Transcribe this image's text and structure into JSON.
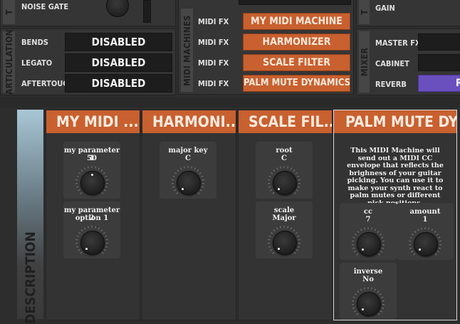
{
  "top_left": {
    "section_tab": "T",
    "noise_gate_label": "NOISE GATE"
  },
  "articulation": {
    "tab_label": "ARTICULATION",
    "rows": [
      {
        "label": "BENDS",
        "value": "DISABLED"
      },
      {
        "label": "LEGATO",
        "value": "DISABLED"
      },
      {
        "label": "AFTERTOUCH",
        "value": "DISABLED"
      }
    ]
  },
  "midi_machines": {
    "tab_label": "MIDI MACHINES",
    "rows": [
      {
        "label": "MIDI FX",
        "value": "MY MIDI MACHINE"
      },
      {
        "label": "MIDI FX",
        "value": "HARMONIZER"
      },
      {
        "label": "MIDI FX",
        "value": "SCALE FILTER"
      },
      {
        "label": "MIDI FX",
        "value": "PALM MUTE DYNAMICS"
      }
    ]
  },
  "top_right": {
    "section_tab": "T",
    "gain_label": "GAIN"
  },
  "mixer": {
    "tab_label": "MIXER",
    "rows": [
      {
        "label": "MASTER FX",
        "value": ""
      },
      {
        "label": "CABINET",
        "value": ""
      },
      {
        "label": "REVERB",
        "value": "R"
      }
    ]
  },
  "description_tab": "DESCRIPTION",
  "machines": [
    {
      "title": "MY MIDI ...",
      "knobs": [
        {
          "label": "my parameter 1",
          "value": "50"
        },
        {
          "label": "my parameter 2",
          "value": "option 1"
        }
      ]
    },
    {
      "title": "HARMONI...",
      "knobs": [
        {
          "label": "major key",
          "value": "C"
        }
      ]
    },
    {
      "title": "SCALE FIL...",
      "knobs": [
        {
          "label": "root",
          "value": "C"
        },
        {
          "label": "scale",
          "value": "Major"
        }
      ]
    },
    {
      "title": "PALM MUTE DY...",
      "description": "This MIDI Machine will send out a MIDI CC envelope that reflects the brighness of your guitar picking. You can use it to make your synth react to palm mutes or different pick positions.",
      "knobs": [
        {
          "label": "cc",
          "value": "7"
        },
        {
          "label": "amount",
          "value": "1"
        },
        {
          "label": "inverse",
          "value": "No"
        }
      ]
    }
  ]
}
